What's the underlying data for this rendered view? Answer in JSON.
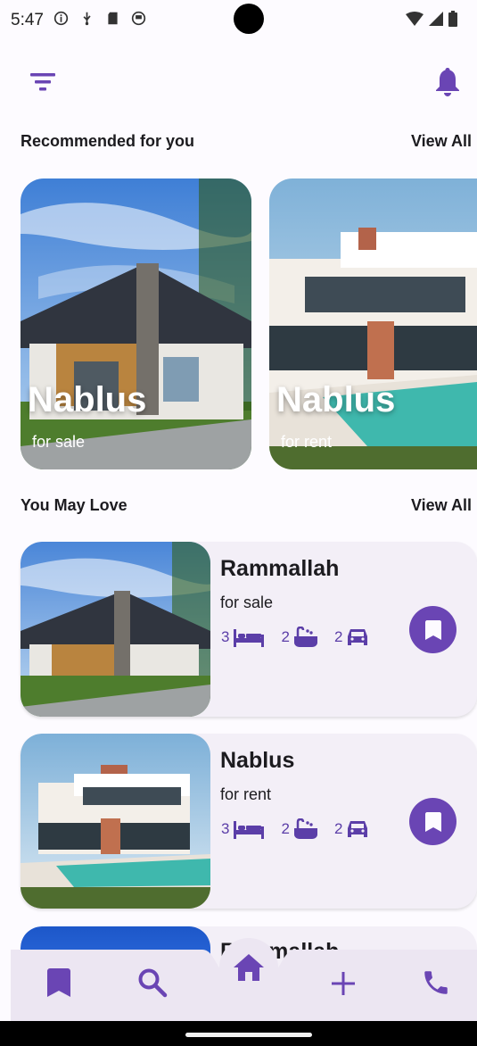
{
  "status_bar": {
    "time": "5:47"
  },
  "recommended": {
    "title": "Recommended for you",
    "view_all": "View All",
    "cards": [
      {
        "city": "Nablus",
        "type": "for sale"
      },
      {
        "city": "Nablus",
        "type": "for rent"
      }
    ]
  },
  "may_love": {
    "title": "You May Love",
    "view_all": "View All",
    "items": [
      {
        "city": "Rammallah",
        "type": "for sale",
        "beds": "3",
        "baths": "2",
        "parking": "2"
      },
      {
        "city": "Nablus",
        "type": "for rent",
        "beds": "3",
        "baths": "2",
        "parking": "2"
      },
      {
        "city": "Rammallah"
      }
    ]
  },
  "bottom_nav": [
    "bookmark-icon",
    "search-icon",
    "home-icon",
    "add-icon",
    "phone-icon"
  ],
  "colors": {
    "accent": "#6a45b4",
    "card_bg": "#f3eff7",
    "background": "#fdfbff"
  }
}
